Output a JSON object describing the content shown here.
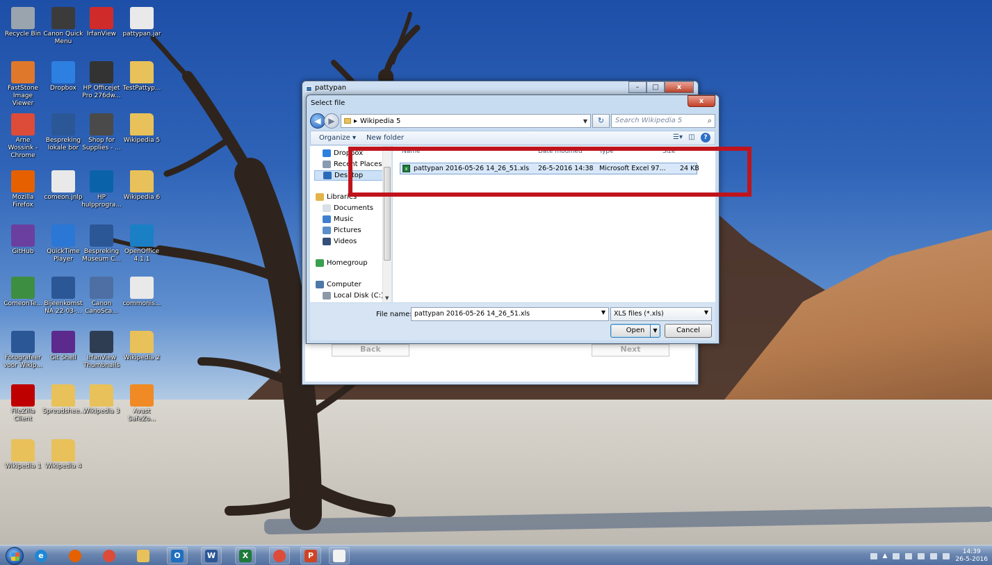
{
  "desktop": {
    "icons": [
      {
        "label": "Recycle Bin",
        "icon": "recycle-bin-icon",
        "color": "#9aa4ae"
      },
      {
        "label": "Canon Quick Menu",
        "icon": "canon-quick-menu-icon",
        "color": "#3b3b3b"
      },
      {
        "label": "IrfanView",
        "icon": "irfanview-icon",
        "color": "#d02b2b"
      },
      {
        "label": "pattypan.jar",
        "icon": "java-jar-icon",
        "color": "#e9e9e9"
      },
      {
        "label": "FastStone Image Viewer",
        "icon": "faststone-icon",
        "color": "#e0782c"
      },
      {
        "label": "Dropbox",
        "icon": "dropbox-icon",
        "color": "#2d7fe0"
      },
      {
        "label": "HP Officejet Pro 276dw...",
        "icon": "printer-icon",
        "color": "#333333"
      },
      {
        "label": "TestPattyp...",
        "icon": "folder-icon",
        "color": "#e8c15a"
      },
      {
        "label": "Arne Wossink - Chrome",
        "icon": "chrome-icon",
        "color": "#dd4b39"
      },
      {
        "label": "Bespreking lokale bor",
        "icon": "word-doc-icon",
        "color": "#2b5797"
      },
      {
        "label": "Shop for Supplies - ...",
        "icon": "shop-supplies-icon",
        "color": "#4a4a4a"
      },
      {
        "label": "Wikipedia 5",
        "icon": "folder-icon",
        "color": "#e8c15a"
      },
      {
        "label": "Mozilla Firefox",
        "icon": "firefox-icon",
        "color": "#e66000"
      },
      {
        "label": "comeon.jnlp",
        "icon": "java-jnlp-icon",
        "color": "#e9e9e9"
      },
      {
        "label": "HP hulpprogra...",
        "icon": "hp-icon",
        "color": "#0a63a8"
      },
      {
        "label": "Wikipedia 6",
        "icon": "folder-icon",
        "color": "#e8c15a"
      },
      {
        "label": "GitHub",
        "icon": "github-icon",
        "color": "#6a3fa0"
      },
      {
        "label": "QuickTime Player",
        "icon": "quicktime-icon",
        "color": "#2a77d6"
      },
      {
        "label": "Bespreking Museum C...",
        "icon": "word-doc-icon",
        "color": "#2b5797"
      },
      {
        "label": "OpenOffice 4.1.1",
        "icon": "openoffice-icon",
        "color": "#1a7fc4"
      },
      {
        "label": "ComeonTe...",
        "icon": "spreadsheet-icon",
        "color": "#3e8e41"
      },
      {
        "label": "Bijeenkomst NA 22-03-...",
        "icon": "word-doc-icon",
        "color": "#2b5797"
      },
      {
        "label": "Canon CanoSca...",
        "icon": "canon-scan-icon",
        "color": "#4d6fa3"
      },
      {
        "label": "commonis...",
        "icon": "java-jar-icon",
        "color": "#e9e9e9"
      },
      {
        "label": "Fotografeer voor Wikip...",
        "icon": "word-doc-icon",
        "color": "#2b5797"
      },
      {
        "label": "Git Shell",
        "icon": "git-shell-icon",
        "color": "#5b2a8c"
      },
      {
        "label": "IrfanView Thumbnails",
        "icon": "irfanview-thumbnails-icon",
        "color": "#2f3d52"
      },
      {
        "label": "Wikipedia 2",
        "icon": "folder-icon",
        "color": "#e8c15a"
      },
      {
        "label": "FileZilla Client",
        "icon": "filezilla-icon",
        "color": "#bf0000"
      },
      {
        "label": "Spreadshee...",
        "icon": "folder-icon",
        "color": "#e8c15a"
      },
      {
        "label": "Wikipedia 3",
        "icon": "folder-icon",
        "color": "#e8c15a"
      },
      {
        "label": "Avast SafeZo...",
        "icon": "avast-icon",
        "color": "#f08a24"
      },
      {
        "label": "Wikipedia 1",
        "icon": "folder-icon",
        "color": "#e8c15a"
      },
      {
        "label": "Wikipedia 4",
        "icon": "folder-icon",
        "color": "#e8c15a"
      }
    ]
  },
  "back_window": {
    "title": "pattypan",
    "controls": {
      "minimize": "–",
      "maximize": "□",
      "close": "x"
    },
    "back_label": "Back",
    "next_label": "Next"
  },
  "dialog": {
    "title": "Select file",
    "close": "x",
    "address": {
      "segment": "Wikipedia 5",
      "separator": "▸"
    },
    "search_placeholder": "Search Wikipedia 5",
    "toolbar": {
      "organize": "Organize ▾",
      "new_folder": "New folder"
    },
    "nav": [
      {
        "label": "Dropbox",
        "icon": "dropbox-icon",
        "color": "#2d7fe0"
      },
      {
        "label": "Recent Places",
        "icon": "recent-places-icon",
        "color": "#8a9bb0"
      },
      {
        "label": "Desktop",
        "icon": "desktop-icon",
        "color": "#2a6bb8"
      },
      {
        "label": "Libraries",
        "icon": "libraries-icon",
        "color": "#e2b44a"
      },
      {
        "label": "Documents",
        "icon": "documents-icon",
        "color": "#d9dfe7"
      },
      {
        "label": "Music",
        "icon": "music-icon",
        "color": "#3f7fd1"
      },
      {
        "label": "Pictures",
        "icon": "pictures-icon",
        "color": "#5a8fc9"
      },
      {
        "label": "Videos",
        "icon": "videos-icon",
        "color": "#34507a"
      },
      {
        "label": "Homegroup",
        "icon": "homegroup-icon",
        "color": "#3aa04f"
      },
      {
        "label": "Computer",
        "icon": "computer-icon",
        "color": "#4d78a8"
      },
      {
        "label": "Local Disk (C:)",
        "icon": "local-disk-icon",
        "color": "#8c9aa8"
      }
    ],
    "columns": {
      "name": "Name",
      "date": "Date modified",
      "type": "Type",
      "size": "Size"
    },
    "files": [
      {
        "name": "pattypan 2016-05-26 14_26_51.xls",
        "date": "26-5-2016 14:38",
        "type": "Microsoft Excel 97...",
        "size": "24 KB"
      }
    ],
    "file_name_label": "File name:",
    "file_name_value": "pattypan 2016-05-26 14_26_51.xls",
    "file_type": "XLS files (*.xls)",
    "open_label": "Open",
    "cancel_label": "Cancel",
    "highlight_color": "#c0141c"
  },
  "taskbar": {
    "apps": [
      {
        "icon": "internet-explorer-icon",
        "glyph": "e",
        "color": "#1e88d6"
      },
      {
        "icon": "firefox-icon",
        "glyph": "",
        "color": "#e66000"
      },
      {
        "icon": "chrome-icon",
        "glyph": "",
        "color": "#dd4b39"
      },
      {
        "icon": "file-explorer-icon",
        "glyph": "",
        "color": "#e8c15a"
      },
      {
        "icon": "outlook-icon",
        "glyph": "O",
        "color": "#1f6fc1"
      },
      {
        "icon": "word-icon",
        "glyph": "W",
        "color": "#2b5797"
      },
      {
        "icon": "excel-icon",
        "glyph": "X",
        "color": "#1f7a3a"
      },
      {
        "icon": "chrome-icon",
        "glyph": "",
        "color": "#dd4b39"
      },
      {
        "icon": "powerpoint-icon",
        "glyph": "P",
        "color": "#d04423"
      },
      {
        "icon": "java-icon",
        "glyph": "",
        "color": "#f2f2f2"
      }
    ],
    "clock_time": "14:39",
    "clock_date": "26-5-2016"
  }
}
